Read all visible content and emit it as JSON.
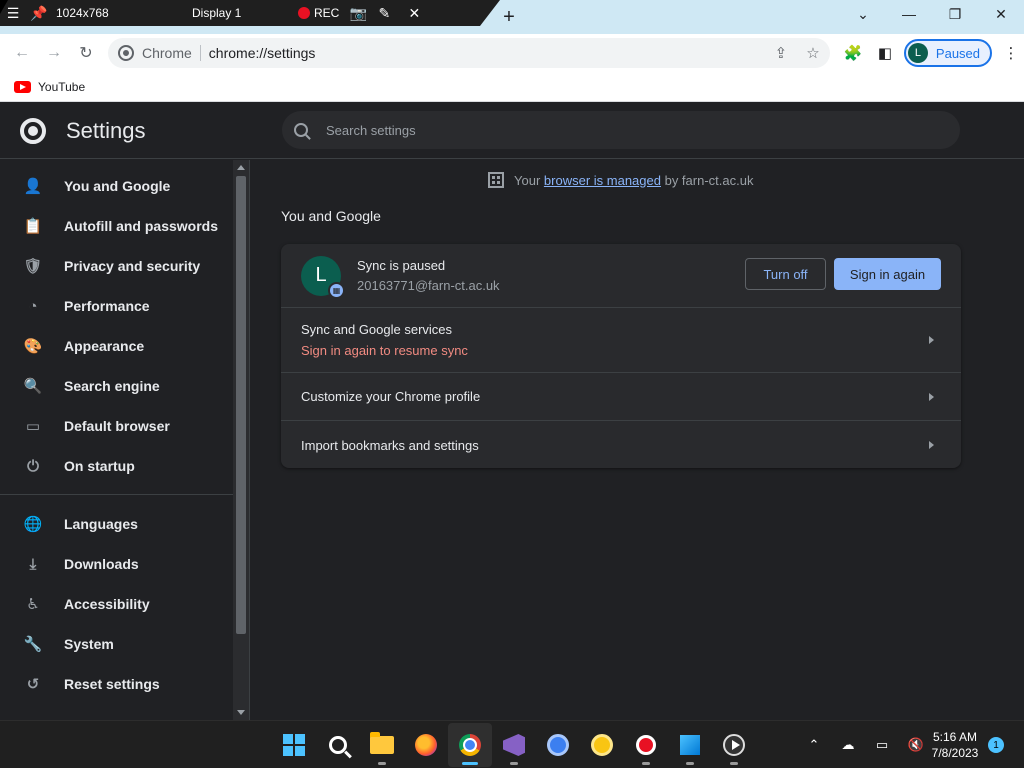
{
  "remote_bar": {
    "resolution": "1024x768",
    "display": "Display 1",
    "rec_label": "REC"
  },
  "tabstrip": {
    "new_tab": "+",
    "minimize": "—",
    "maximize": "❐",
    "close": "✕",
    "dropdown": "⌄"
  },
  "toolbar": {
    "omnibox_chip": "Chrome",
    "url": "chrome://settings",
    "profile_initial": "L",
    "profile_status": "Paused"
  },
  "bookmarks": [
    {
      "label": "YouTube"
    }
  ],
  "settings": {
    "title": "Settings",
    "search_placeholder": "Search settings"
  },
  "sidebar": {
    "group1": [
      {
        "label": "You and Google",
        "icon": "person-icon",
        "glyph": "👤"
      },
      {
        "label": "Autofill and passwords",
        "icon": "clipboard-icon",
        "glyph": "📋"
      },
      {
        "label": "Privacy and security",
        "icon": "shield-icon",
        "glyph": "🛡"
      },
      {
        "label": "Performance",
        "icon": "speedometer-icon",
        "glyph": "◔"
      },
      {
        "label": "Appearance",
        "icon": "palette-icon",
        "glyph": "🎨"
      },
      {
        "label": "Search engine",
        "icon": "search-icon",
        "glyph": "🔍"
      },
      {
        "label": "Default browser",
        "icon": "browser-icon",
        "glyph": "▭"
      },
      {
        "label": "On startup",
        "icon": "power-icon",
        "glyph": "⏻"
      }
    ],
    "group2": [
      {
        "label": "Languages",
        "icon": "globe-icon",
        "glyph": "🌐"
      },
      {
        "label": "Downloads",
        "icon": "download-icon",
        "glyph": "⤓"
      },
      {
        "label": "Accessibility",
        "icon": "accessibility-icon",
        "glyph": "♿"
      },
      {
        "label": "System",
        "icon": "wrench-icon",
        "glyph": "🔧"
      },
      {
        "label": "Reset settings",
        "icon": "reset-icon",
        "glyph": "↺"
      }
    ]
  },
  "main": {
    "managed_prefix": "Your",
    "managed_link": "browser is managed",
    "managed_suffix": "by farn-ct.ac.uk",
    "section_title": "You and Google",
    "sync": {
      "avatar_initial": "L",
      "status": "Sync is paused",
      "email": "20163771@farn-ct.ac.uk",
      "turn_off": "Turn off",
      "sign_in_again": "Sign in again"
    },
    "rows": [
      {
        "label": "Sync and Google services",
        "sub": "Sign in again to resume sync"
      },
      {
        "label": "Customize your Chrome profile"
      },
      {
        "label": "Import bookmarks and settings"
      }
    ]
  },
  "taskbar": {
    "time": "5:16 AM",
    "date": "7/8/2023",
    "notifications": "1"
  }
}
